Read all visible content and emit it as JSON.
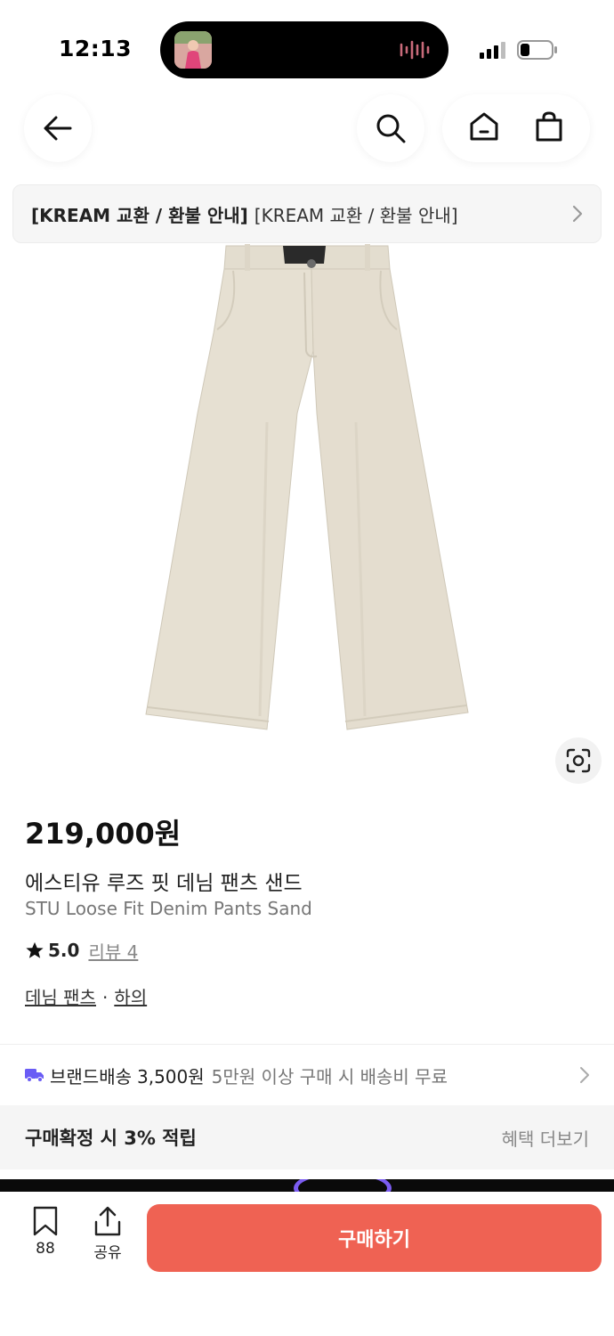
{
  "status_bar": {
    "time": "12:13"
  },
  "notice": {
    "bold_text": "[KREAM 교환 / 환불 안내]",
    "text": "[KREAM 교환 / 환불 안내]"
  },
  "product": {
    "price": "219,000원",
    "name_ko": "에스티유 루즈 핏 데님 팬츠 샌드",
    "name_en": "STU Loose Fit Denim Pants Sand",
    "rating": "5.0",
    "review_label": "리뷰 4",
    "category_1": "데님 팬츠",
    "category_separator": "·",
    "category_2": "하의"
  },
  "delivery": {
    "label": "브랜드배송",
    "fee": "3,500원",
    "condition": "5만원 이상 구매 시 배송비 무료"
  },
  "reward": {
    "text": "구매확정 시 3% 적립",
    "more": "혜택 더보기"
  },
  "bottom_bar": {
    "save_count": "88",
    "share_label": "공유",
    "buy_label": "구매하기"
  },
  "colors": {
    "buy_button": "#ef6253",
    "pants": "#e6e0d2",
    "delivery_icon": "#6a5cf5"
  }
}
